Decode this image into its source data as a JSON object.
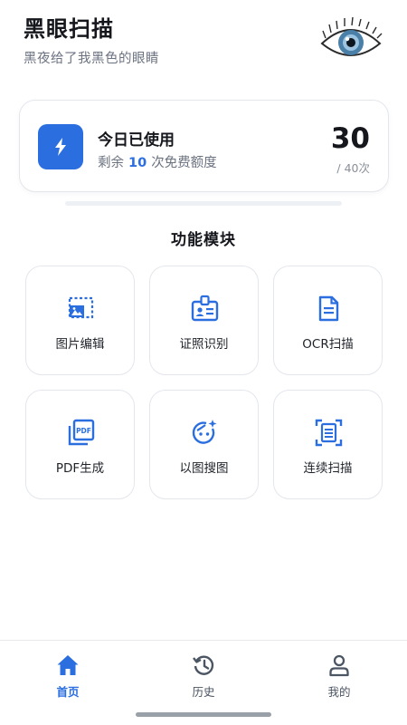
{
  "header": {
    "title": "黑眼扫描",
    "subtitle": "黑夜给了我黑色的眼睛",
    "logo_icon": "eye-icon"
  },
  "usage": {
    "title": "今日已使用",
    "remain_prefix": "剩余",
    "remain_count": "10",
    "remain_suffix": "次免费额度",
    "used_count": "30",
    "total_label": "/ 40次",
    "progress_fraction": 0.75,
    "accent_color": "#2a6ee0",
    "icon": "lightning-icon"
  },
  "features": {
    "section_title": "功能模块",
    "items": [
      {
        "label": "图片编辑",
        "icon": "image-edit-icon"
      },
      {
        "label": "证照识别",
        "icon": "id-card-icon"
      },
      {
        "label": "OCR扫描",
        "icon": "document-icon"
      },
      {
        "label": "PDF生成",
        "icon": "pdf-icon"
      },
      {
        "label": "以图搜图",
        "icon": "face-search-icon"
      },
      {
        "label": "连续扫描",
        "icon": "scan-frame-icon"
      }
    ]
  },
  "nav": {
    "items": [
      {
        "label": "首页",
        "icon": "home-icon",
        "active": true
      },
      {
        "label": "历史",
        "icon": "history-icon",
        "active": false
      },
      {
        "label": "我的",
        "icon": "user-icon",
        "active": false
      }
    ]
  }
}
